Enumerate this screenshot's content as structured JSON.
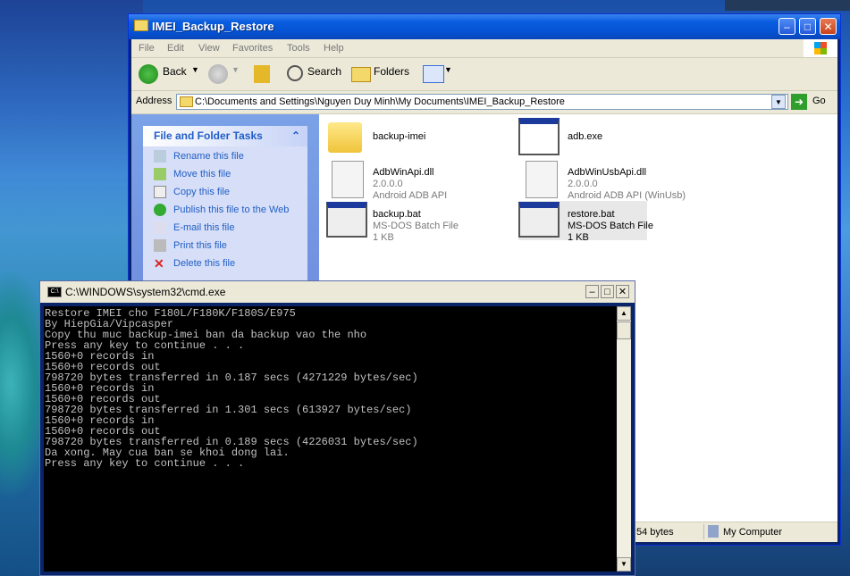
{
  "explorer": {
    "title": "IMEI_Backup_Restore",
    "menu": [
      "File",
      "Edit",
      "View",
      "Favorites",
      "Tools",
      "Help"
    ],
    "toolbar": {
      "back": "Back",
      "search": "Search",
      "folders": "Folders"
    },
    "address": {
      "label": "Address",
      "path": "C:\\Documents and Settings\\Nguyen Duy Minh\\My Documents\\IMEI_Backup_Restore",
      "go": "Go"
    },
    "tasks": {
      "header": "File and Folder Tasks",
      "items": [
        "Rename this file",
        "Move this file",
        "Copy this file",
        "Publish this file to the Web",
        "E-mail this file",
        "Print this file",
        "Delete this file"
      ]
    },
    "files": [
      {
        "name": "backup-imei",
        "line2": "",
        "line3": "",
        "icon": "folder-icon"
      },
      {
        "name": "adb.exe",
        "line2": "",
        "line3": "",
        "icon": "exe-icon"
      },
      {
        "name": "AdbWinApi.dll",
        "line2": "2.0.0.0",
        "line3": "Android ADB API",
        "icon": "dll-icon"
      },
      {
        "name": "AdbWinUsbApi.dll",
        "line2": "2.0.0.0",
        "line3": "Android ADB API (WinUsb)",
        "icon": "dll-icon"
      },
      {
        "name": "backup.bat",
        "line2": "MS-DOS Batch File",
        "line3": "1 KB",
        "icon": "bat-icon"
      },
      {
        "name": "restore.bat",
        "line2": "MS-DOS Batch File",
        "line3": "1 KB",
        "icon": "bat-icon"
      }
    ],
    "status": {
      "size": "54 bytes",
      "location": "My Computer"
    }
  },
  "cmd": {
    "title": "C:\\WINDOWS\\system32\\cmd.exe",
    "lines": [
      "Restore IMEI cho F180L/F180K/F180S/E975",
      "By HiepGia/Vipcasper",
      "Copy thu muc backup-imei ban da backup vao the nho",
      "Press any key to continue . . .",
      "1560+0 records in",
      "1560+0 records out",
      "798720 bytes transferred in 0.187 secs (4271229 bytes/sec)",
      "1560+0 records in",
      "1560+0 records out",
      "798720 bytes transferred in 1.301 secs (613927 bytes/sec)",
      "1560+0 records in",
      "1560+0 records out",
      "798720 bytes transferred in 0.189 secs (4226031 bytes/sec)",
      "Da xong. May cua ban se khoi dong lai.",
      "Press any key to continue . . ."
    ]
  }
}
